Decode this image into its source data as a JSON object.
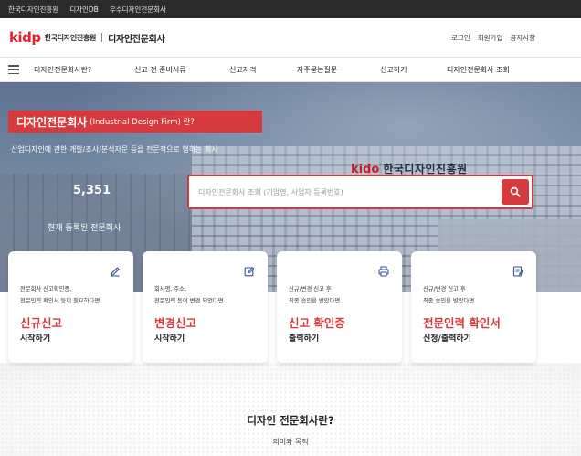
{
  "topbar": {
    "links": [
      "한국디자인진흥원",
      "디자인DB",
      "우수디자인전문회사"
    ]
  },
  "header": {
    "logo_mark": "kidp",
    "logo_org": "한국디자인진흥원",
    "site_title": "디자인전문회사",
    "links": [
      "로그인",
      "회원가입",
      "공지사항"
    ]
  },
  "nav": {
    "items": [
      "디자인전문회사란?",
      "신고 전 준비서류",
      "신고자격",
      "자주묻는질문",
      "신고하기",
      "디자인전문회사 조회"
    ]
  },
  "hero": {
    "title_main": "디자인전문회사",
    "title_sub": "(Industrial Design Firm) 란?",
    "description": "산업디자인에 관한 개발/조사/분석자문 등을 전문적으로 행하는 회사",
    "count": "5,351",
    "count_label": "현재 등록된 전문회사",
    "sign_mark": "kido",
    "sign_text": "한국디자인진흥원"
  },
  "search": {
    "placeholder": "디자인전문회사 조회 (기업명, 사업자 등록번호)",
    "value": "",
    "icon": "search-icon"
  },
  "cards": [
    {
      "icon": "pencil-icon",
      "desc": [
        "전문회사 신고확인증,",
        "전문인력 확인서 등이 필요하다면"
      ],
      "title": "신규신고",
      "sub": "시작하기"
    },
    {
      "icon": "edit-icon",
      "desc": [
        "회사명, 주소,",
        "전문인력 등이 변경 되었다면"
      ],
      "title": "변경신고",
      "sub": "시작하기"
    },
    {
      "icon": "printer-icon",
      "desc": [
        "신규/변경 신고 후",
        "최종 승인을 받았다면"
      ],
      "title": "신고 확인증",
      "sub": "출력하기"
    },
    {
      "icon": "document-icon",
      "desc": [
        "신규/변경 신고 후",
        "최종 승인을 받았다면"
      ],
      "title": "전문인력 확인서",
      "sub": "신청/출력하기"
    }
  ],
  "section": {
    "title": "디자인 전문회사란?",
    "subtitle": "의미와 목적"
  },
  "colors": {
    "accent": "#d63a3e",
    "topbar": "#2b2b2b"
  }
}
